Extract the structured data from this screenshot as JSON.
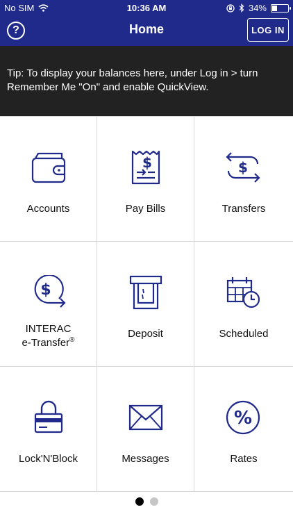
{
  "status_bar": {
    "carrier": "No SIM",
    "time": "10:36 AM",
    "battery_text": "34%",
    "battery_level": 0.34
  },
  "header": {
    "help_label": "?",
    "title": "Home",
    "login_label": "LOG IN"
  },
  "tip": {
    "text": "Tip: To display your balances here, under Log in > turn Remember Me \"On\" and enable QuickView."
  },
  "tiles": [
    {
      "label": "Accounts",
      "icon": "wallet-icon"
    },
    {
      "label": "Pay Bills",
      "icon": "bill-icon"
    },
    {
      "label": "Transfers",
      "icon": "transfer-icon"
    },
    {
      "label": "INTERAC",
      "label2": "e-Transfer",
      "sup": "®",
      "icon": "etransfer-icon"
    },
    {
      "label": "Deposit",
      "icon": "atm-icon"
    },
    {
      "label": "Scheduled",
      "icon": "calendar-icon"
    },
    {
      "label": "Lock'N'Block",
      "icon": "lock-card-icon"
    },
    {
      "label": "Messages",
      "icon": "envelope-icon"
    },
    {
      "label": "Rates",
      "icon": "percent-icon"
    }
  ],
  "pager": {
    "pages": 2,
    "active": 0
  },
  "colors": {
    "brand": "#1f2a8a",
    "tip_bg": "#222222",
    "icon": "#1f2a8a",
    "divider": "#d6d6d6"
  }
}
